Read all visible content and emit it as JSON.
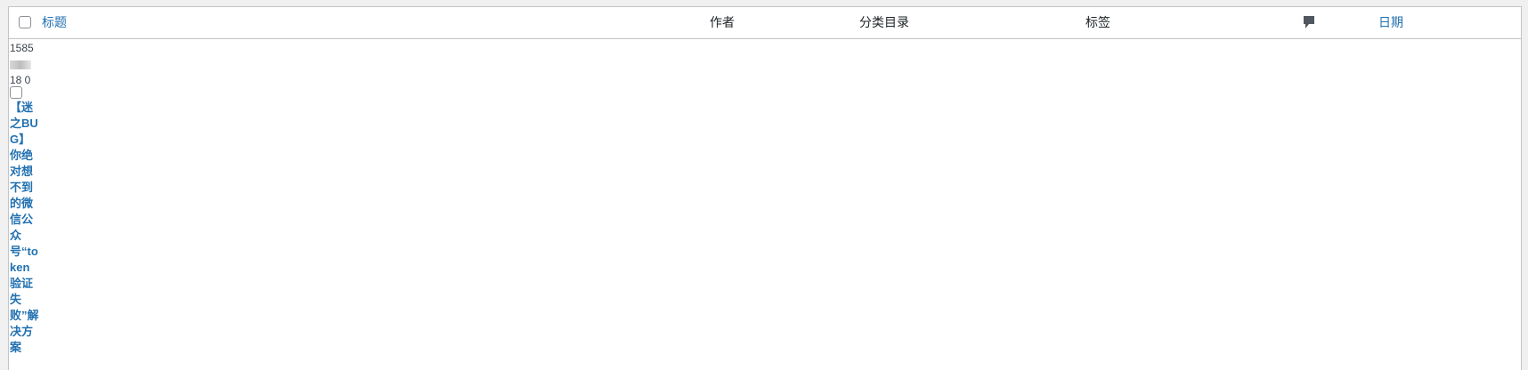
{
  "table": {
    "columns": {
      "title": "标题",
      "author": "作者",
      "categories": "分类目录",
      "tags": "标签",
      "comments_icon": "comment-icon",
      "date": "日期"
    },
    "row": {
      "meta_line1": "1585",
      "meta_line3": "18 0",
      "title": "【迷之BUG】你绝对想不到的微信公众号“token验证失败”解决方案"
    }
  }
}
